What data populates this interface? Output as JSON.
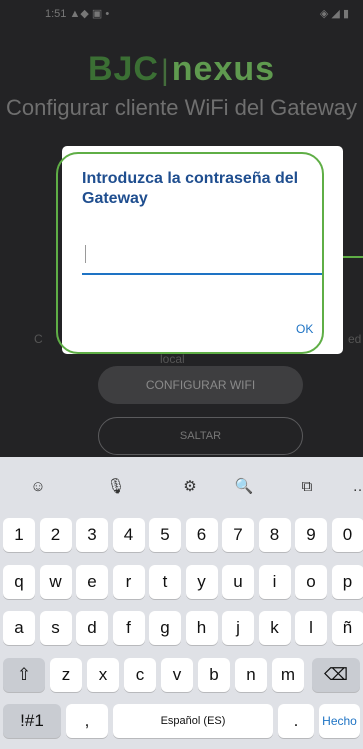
{
  "status_bar": {
    "left": "1:51 ▲◆ ▣ •",
    "right": "◈ ◢ ▮"
  },
  "brand": {
    "part1": "BJC",
    "separator": "|",
    "part2": "nexus"
  },
  "screen_title": "Configurar cliente WiFi del Gateway",
  "background_fragments": {
    "left": "C",
    "right": "ed",
    "center": "local"
  },
  "buttons": {
    "configure": "CONFIGURAR WIFI",
    "skip": "SALTAR"
  },
  "dialog": {
    "title": "Introduzca la contraseña del Gateway",
    "ok": "OK",
    "password_value": ""
  },
  "keyboard_toolbar": [
    "☺",
    "🎙",
    "⚙",
    "🔍",
    "⧉",
    "…"
  ],
  "keyboard": {
    "row1": [
      "1",
      "2",
      "3",
      "4",
      "5",
      "6",
      "7",
      "8",
      "9",
      "0"
    ],
    "row2": [
      "q",
      "w",
      "e",
      "r",
      "t",
      "y",
      "u",
      "i",
      "o",
      "p"
    ],
    "row3": [
      "a",
      "s",
      "d",
      "f",
      "g",
      "h",
      "j",
      "k",
      "l",
      "ñ"
    ],
    "row4": [
      "z",
      "x",
      "c",
      "v",
      "b",
      "n",
      "m"
    ],
    "shift": "⇧",
    "backspace": "⌫",
    "symbols": "!#1",
    "comma": ",",
    "space": "Español (ES)",
    "period": ".",
    "done": "Hecho"
  },
  "colors": {
    "accent": "#5fae46",
    "dialog_title": "#1f4e8f",
    "link": "#1e73c4"
  }
}
